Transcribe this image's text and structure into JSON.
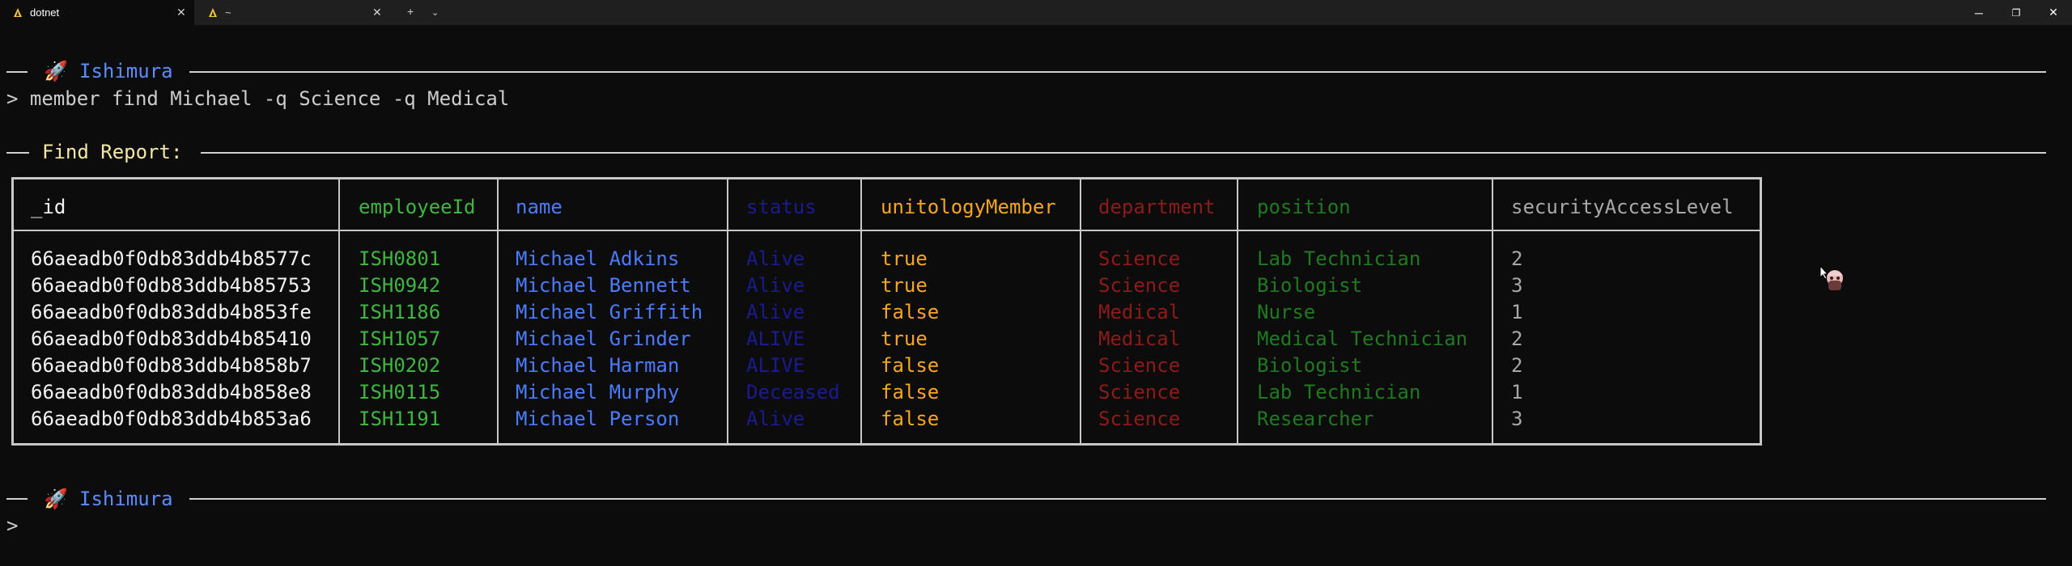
{
  "tabs": [
    {
      "label": "dotnet",
      "active": true
    },
    {
      "label": "~",
      "active": false
    }
  ],
  "colors": {
    "prompt_label": "#5b8cff",
    "report_title": "#f4e7a6",
    "id": "#f2f2f2",
    "employeeId": "#3fb63f",
    "name": "#4b7cff",
    "status": "#1b1b8f",
    "unitologyMember": "#f6a623",
    "department": "#8e1a1a",
    "position": "#1f7a1f",
    "securityAccessLevel": "#a8a8a8"
  },
  "header": {
    "icon": "rocket-icon",
    "title": "Ishimura"
  },
  "command": "> member find Michael -q Science -q Medical",
  "report_title": "Find Report:",
  "columns": [
    "_id",
    "employeeId",
    "name",
    "status",
    "unitologyMember",
    "department",
    "position",
    "securityAccessLevel"
  ],
  "rows": [
    [
      "66aeadb0f0db83ddb4b8577c",
      "ISH0801",
      "Michael Adkins",
      "Alive",
      "true",
      "Science",
      "Lab Technician",
      "2"
    ],
    [
      "66aeadb0f0db83ddb4b85753",
      "ISH0942",
      "Michael Bennett",
      "Alive",
      "true",
      "Science",
      "Biologist",
      "3"
    ],
    [
      "66aeadb0f0db83ddb4b853fe",
      "ISH1186",
      "Michael Griffith",
      "Alive",
      "false",
      "Medical",
      "Nurse",
      "1"
    ],
    [
      "66aeadb0f0db83ddb4b85410",
      "ISH1057",
      "Michael Grinder",
      "ALIVE",
      "true",
      "Medical",
      "Medical Technician",
      "2"
    ],
    [
      "66aeadb0f0db83ddb4b858b7",
      "ISH0202",
      "Michael Harman",
      "ALIVE",
      "false",
      "Science",
      "Biologist",
      "2"
    ],
    [
      "66aeadb0f0db83ddb4b858e8",
      "ISH0115",
      "Michael Murphy",
      "Deceased",
      "false",
      "Science",
      "Lab Technician",
      "1"
    ],
    [
      "66aeadb0f0db83ddb4b853a6",
      "ISH1191",
      "Michael Person",
      "Alive",
      "false",
      "Science",
      "Researcher",
      "3"
    ]
  ],
  "footer": {
    "icon": "rocket-icon",
    "title": "Ishimura",
    "prompt": ">"
  }
}
